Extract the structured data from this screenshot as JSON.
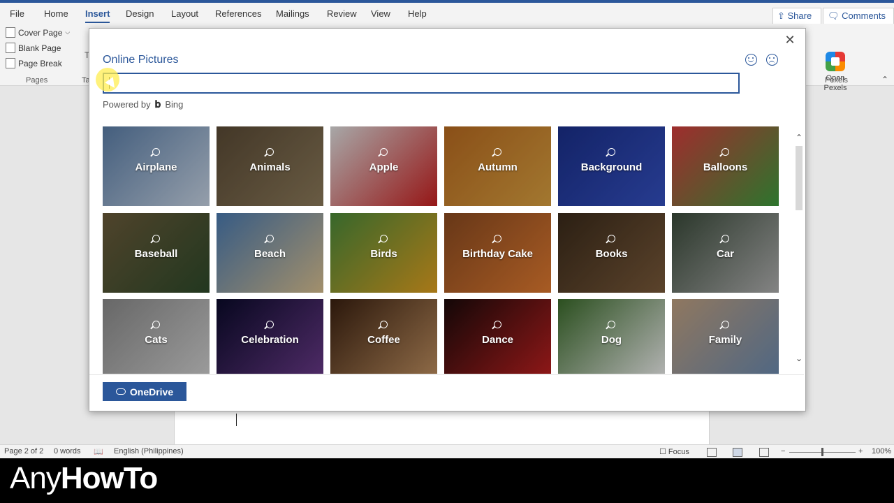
{
  "menu": {
    "tabs": [
      "File",
      "Home",
      "Insert",
      "Design",
      "Layout",
      "References",
      "Mailings",
      "Review",
      "View",
      "Help"
    ],
    "share": "Share",
    "comments": "Comments"
  },
  "ribbon": {
    "cover_page": "Cover Page",
    "blank_page": "Blank Page",
    "page_break": "Page Break",
    "pages_group": "Pages",
    "ta_fragment": "Ta",
    "t_fragment": "T",
    "open_pexels_1": "Open",
    "open_pexels_2": "Pexels",
    "pexels_group": "Pexels"
  },
  "dialog": {
    "title": "Online Pictures",
    "search_value": "",
    "powered_by": "Powered by",
    "bing": "Bing",
    "onedrive": "OneDrive",
    "tiles": [
      {
        "label": "Airplane",
        "colors": [
          "#5b7ea8",
          "#c7d4e4"
        ]
      },
      {
        "label": "Animals",
        "colors": [
          "#5a4a35",
          "#8c7a5a"
        ]
      },
      {
        "label": "Apple",
        "colors": [
          "#e0e0e0",
          "#c81e1e"
        ]
      },
      {
        "label": "Autumn",
        "colors": [
          "#b86a20",
          "#d9a040"
        ]
      },
      {
        "label": "Background",
        "colors": [
          "#1a2f8a",
          "#3450c0"
        ]
      },
      {
        "label": "Balloons",
        "colors": [
          "#d43c3c",
          "#3c9c3c"
        ]
      },
      {
        "label": "Baseball",
        "colors": [
          "#6a5a3a",
          "#2e4a2a"
        ]
      },
      {
        "label": "Beach",
        "colors": [
          "#4a7ab0",
          "#d9c090"
        ]
      },
      {
        "label": "Birds",
        "colors": [
          "#4a8a3a",
          "#e0a020"
        ]
      },
      {
        "label": "Birthday Cake",
        "colors": [
          "#8a4a20",
          "#e07a30"
        ]
      },
      {
        "label": "Books",
        "colors": [
          "#3a2a1a",
          "#7a5a3a"
        ]
      },
      {
        "label": "Car",
        "colors": [
          "#3a4a3a",
          "#b0b0b0"
        ]
      },
      {
        "label": "Cats",
        "colors": [
          "#8a8a8a",
          "#d0d0d0"
        ]
      },
      {
        "label": "Celebration",
        "colors": [
          "#0a0a2a",
          "#6a3a8a"
        ]
      },
      {
        "label": "Coffee",
        "colors": [
          "#3a2010",
          "#c09060"
        ]
      },
      {
        "label": "Dance",
        "colors": [
          "#1a0a0a",
          "#c02020"
        ]
      },
      {
        "label": "Dog",
        "colors": [
          "#3a6a2a",
          "#f0f0f0"
        ]
      },
      {
        "label": "Family",
        "colors": [
          "#c0a080",
          "#6a8ab0"
        ]
      }
    ]
  },
  "status": {
    "page": "Page 2 of 2",
    "words": "0 words",
    "language": "English (Philippines)",
    "focus": "Focus",
    "zoom_minus": "−",
    "zoom_plus": "+",
    "zoom": "100%"
  },
  "brand": {
    "any": "Any",
    "howto": "HowTo"
  }
}
